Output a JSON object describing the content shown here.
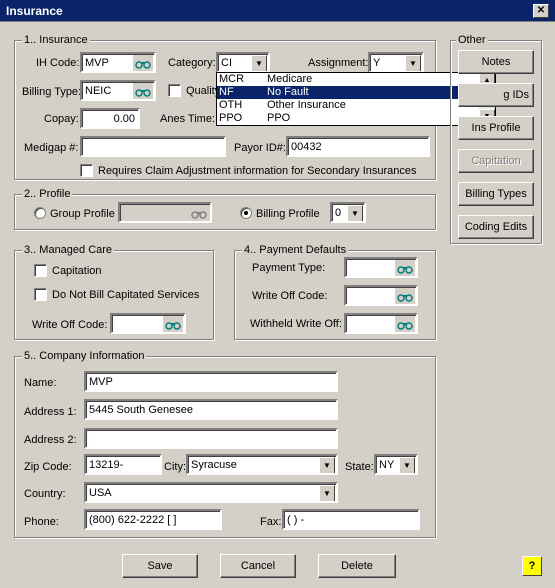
{
  "window": {
    "title": "Insurance",
    "close_glyph": "✕"
  },
  "insurance": {
    "legend": "1.. Insurance",
    "ih_code_label": "IH Code:",
    "ih_code": "MVP",
    "category_label": "Category:",
    "category": "CI",
    "assignment_label": "Assignment:",
    "assignment": "Y",
    "billing_type_label": "Billing Type:",
    "billing_type": "NEIC",
    "quality_label": "Quality",
    "copay_label": "Copay:",
    "copay": "0.00",
    "anes_time_label": "Anes Time:",
    "medigap_label": "Medigap #:",
    "medigap": "",
    "payor_id_label": "Payor ID#:",
    "payor_id": "00432",
    "claim_adj_label": "Requires Claim Adjustment information for Secondary Insurances"
  },
  "category_dropdown": {
    "items": [
      {
        "code": "MCR",
        "name": "Medicare"
      },
      {
        "code": "NF",
        "name": "No Fault"
      },
      {
        "code": "OTH",
        "name": "Other Insurance"
      },
      {
        "code": "PPO",
        "name": "PPO"
      }
    ]
  },
  "profile": {
    "legend": "2.. Profile",
    "group_profile_label": "Group Profile",
    "billing_profile_label": "Billing Profile",
    "billing_profile_value": "0"
  },
  "managed_care": {
    "legend": "3.. Managed Care",
    "capitation_label": "Capitation",
    "do_not_bill_label": "Do Not Bill Capitated Services",
    "write_off_label": "Write Off Code:"
  },
  "payment_defaults": {
    "legend": "4.. Payment Defaults",
    "payment_type_label": "Payment Type:",
    "write_off_label": "Write Off Code:",
    "withheld_label": "Withheld Write Off:"
  },
  "company": {
    "legend": "5.. Company Information",
    "name_label": "Name:",
    "name": "MVP",
    "address1_label": "Address 1:",
    "address1": "5445 South Genesee",
    "address2_label": "Address 2:",
    "address2": "",
    "zip_label": "Zip Code:",
    "zip": "13219-",
    "city_label": "City:",
    "city": "Syracuse",
    "state_label": "State:",
    "state": "NY",
    "country_label": "Country:",
    "country": "USA",
    "phone_label": "Phone:",
    "phone": "(800) 622-2222 [      ]",
    "fax_label": "Fax:",
    "fax": "(    )     -"
  },
  "other": {
    "legend": "Other",
    "notes": "Notes",
    "billing_ids": "g IDs",
    "ins_profile": "Ins Profile",
    "capitation": "Capitation",
    "billing_types": "Billing Types",
    "coding_edits": "Coding Edits"
  },
  "footer": {
    "save": "Save",
    "cancel": "Cancel",
    "delete": "Delete",
    "help": "?"
  },
  "icons": {
    "lookup": "binoculars-icon",
    "arrow_down": "▼",
    "arrow_up": "▲"
  }
}
